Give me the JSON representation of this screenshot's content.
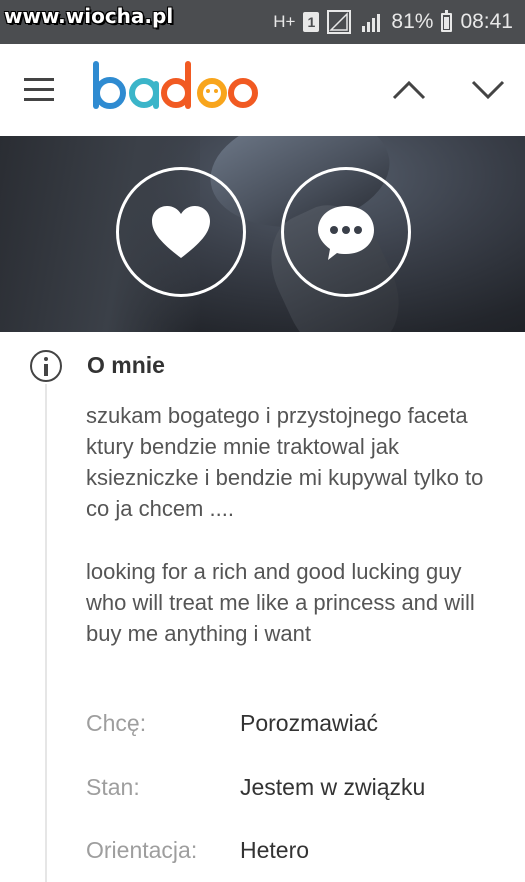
{
  "status_bar": {
    "watermark": "www.wiocha.pl",
    "network": "H+",
    "sim": "1",
    "battery": "81%",
    "time": "08:41",
    "icons": [
      "hplus-icon",
      "sim-icon",
      "signal-icon",
      "signal-icon",
      "battery-icon"
    ]
  },
  "header": {
    "logo": "badoo",
    "icons": [
      "menu-icon",
      "chevron-up-icon",
      "chevron-down-icon"
    ],
    "logo_colors": {
      "b": "#2f8bd1",
      "a": "#3bb5c9",
      "d": "#f15a22",
      "o1": "#f8a51c",
      "o2": "#f15a22"
    }
  },
  "profile_actions": {
    "icons": [
      "heart-icon",
      "chat-bubble-icon"
    ]
  },
  "about": {
    "title": "O mnie",
    "icon": "info-icon",
    "bio_pl": "szukam bogatego i przystojnego faceta ktury bendzie mnie traktowal jak ksiezniczke i bendzie mi kupywal tylko to co ja chcem ....",
    "bio_en": "looking for a rich and good lucking guy who will treat me like a princess and will buy me anything i want",
    "details": [
      {
        "label": "Chcę:",
        "value": "Porozmawiać"
      },
      {
        "label": "Stan:",
        "value": "Jestem w związku"
      },
      {
        "label": "Orientacja:",
        "value": "Hetero"
      }
    ]
  }
}
